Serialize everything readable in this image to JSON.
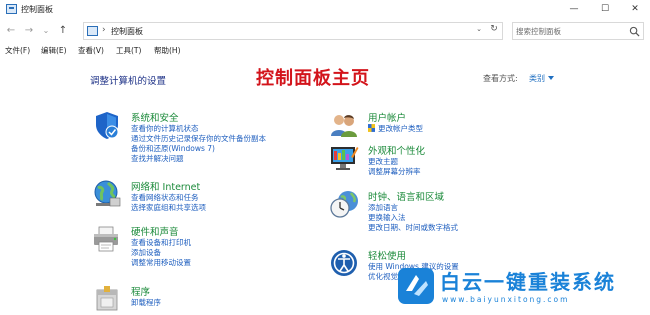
{
  "window": {
    "title": "控制面板",
    "minimize": "—",
    "maximize": "☐",
    "close": "✕"
  },
  "nav": {
    "back": "←",
    "forward": "→",
    "recent": "⌄",
    "up": "↑",
    "breadcrumb_sep": "›",
    "breadcrumb": "控制面板",
    "dropdown": "⌄",
    "refresh": "↻"
  },
  "search": {
    "placeholder": "搜索控制面板"
  },
  "menu": [
    "文件(F)",
    "编辑(E)",
    "查看(V)",
    "工具(T)",
    "帮助(H)"
  ],
  "content": {
    "adjust_title": "调整计算机的设置",
    "big_title": "控制面板主页",
    "view_by_label": "查看方式:",
    "view_by_value": "类别"
  },
  "categories": {
    "system": {
      "title": "系统和安全",
      "icon": "shield-icon",
      "links": [
        "查看你的计算机状态",
        "通过文件历史记录保存你的文件备份副本",
        "备份和还原(Windows 7)",
        "查找并解决问题"
      ]
    },
    "network": {
      "title": "网络和 Internet",
      "icon": "globe-network-icon",
      "links": [
        "查看网络状态和任务",
        "选择家庭组和共享选项"
      ]
    },
    "hardware": {
      "title": "硬件和声音",
      "icon": "printer-icon",
      "links": [
        "查看设备和打印机",
        "添加设备",
        "调整常用移动设置"
      ]
    },
    "programs": {
      "title": "程序",
      "icon": "programs-icon",
      "links": [
        "卸载程序"
      ]
    },
    "users": {
      "title": "用户帐户",
      "icon": "users-icon",
      "links": [
        "更改帐户类型"
      ]
    },
    "appearance": {
      "title": "外观和个性化",
      "icon": "monitor-icon",
      "links": [
        "更改主题",
        "调整屏幕分辨率"
      ]
    },
    "clock": {
      "title": "时钟、语言和区域",
      "icon": "clock-globe-icon",
      "links": [
        "添加语言",
        "更换输入法",
        "更改日期、时间或数字格式"
      ]
    },
    "ease": {
      "title": "轻松使用",
      "icon": "ease-of-access-icon",
      "links": [
        "使用 Windows 建议的设置",
        "优化视觉显示"
      ]
    }
  },
  "watermark": {
    "text": "白云一键重装系统",
    "url": "www.baiyunxitong.com"
  },
  "colors": {
    "category_title": "#1b8a3a",
    "link": "#1f5fbf",
    "heading": "#1e3287",
    "big_title": "#d3141b",
    "watermark": "#1a82d8"
  }
}
